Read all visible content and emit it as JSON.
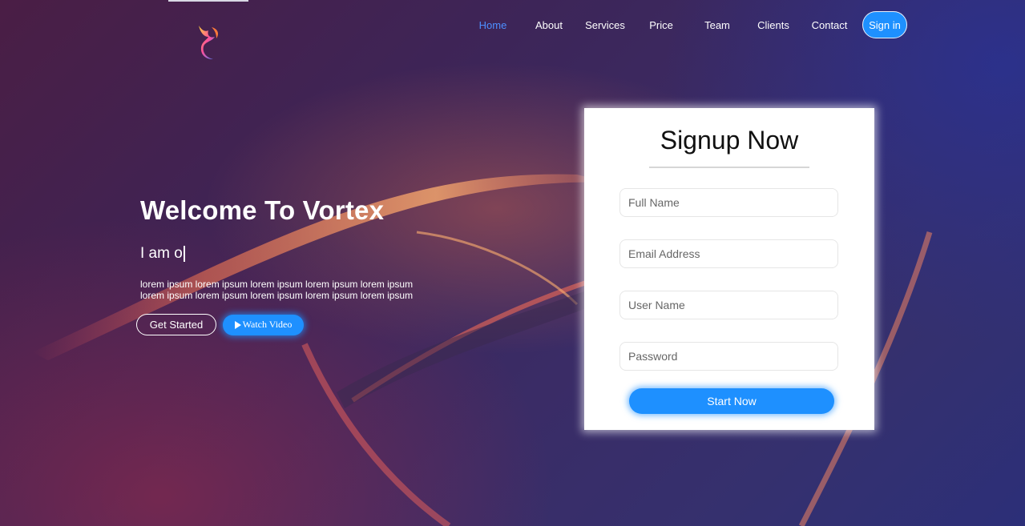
{
  "nav": {
    "items": [
      {
        "label": "Home",
        "active": true
      },
      {
        "label": "About"
      },
      {
        "label": "Services"
      },
      {
        "label": "Price"
      },
      {
        "label": "Team"
      },
      {
        "label": "Clients"
      },
      {
        "label": "Contact"
      }
    ],
    "signin_label": "Sign in"
  },
  "hero": {
    "title": "Welcome To Vortex",
    "typed_text": "I am o",
    "description": "lorem ipsum lorem ipsum lorem ipsum lorem ipsum lorem ipsum lorem ipsum lorem ipsum lorem ipsum lorem ipsum lorem ipsum",
    "get_started_label": "Get Started",
    "watch_video_label": "Watch Video"
  },
  "signup": {
    "title": "Signup Now",
    "fields": {
      "full_name": {
        "placeholder": "Full Name",
        "value": ""
      },
      "email": {
        "placeholder": "Email Address",
        "value": ""
      },
      "username": {
        "placeholder": "User Name",
        "value": ""
      },
      "password": {
        "placeholder": "Password",
        "value": ""
      }
    },
    "submit_label": "Start Now"
  },
  "colors": {
    "accent": "#1e90ff",
    "active_nav": "#4d8fff"
  },
  "icons": {
    "logo": "phoenix-logo-icon",
    "play": "play-icon"
  }
}
